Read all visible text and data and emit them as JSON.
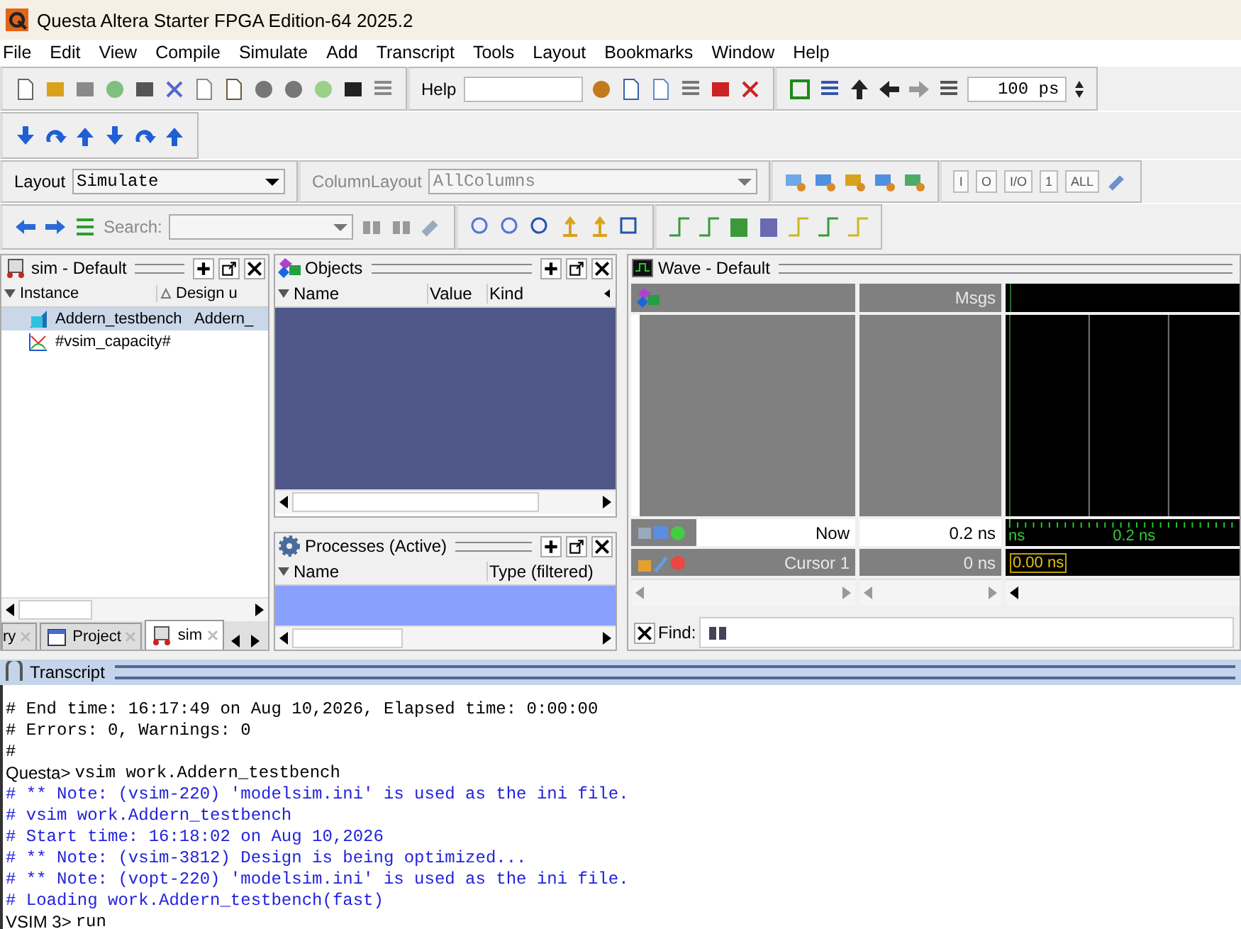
{
  "window": {
    "title": "Questa Altera Starter FPGA Edition-64 2025.2"
  },
  "menu": [
    "File",
    "Edit",
    "View",
    "Compile",
    "Simulate",
    "Add",
    "Transcript",
    "Tools",
    "Layout",
    "Bookmarks",
    "Window",
    "Help"
  ],
  "toolbar": {
    "help_label": "Help",
    "time_step": "100 ps",
    "layout_label": "Layout",
    "layout_value": "Simulate",
    "column_layout_label": "ColumnLayout",
    "column_layout_value": "AllColumns",
    "search_label": "Search:"
  },
  "filter_buttons": [
    "I",
    "O",
    "I/O",
    "1",
    "ALL"
  ],
  "sim_pane": {
    "title": "sim - Default",
    "columns": [
      "Instance",
      "Design u"
    ],
    "rows": [
      {
        "instance": "Addern_testbench",
        "design_unit": "Addern_",
        "kind": "module",
        "selected": true
      },
      {
        "instance": "#vsim_capacity#",
        "kind": "capacity",
        "selected": false
      }
    ]
  },
  "tabs": [
    {
      "label": "ry",
      "selected": false
    },
    {
      "label": "Project",
      "selected": false
    },
    {
      "label": "sim",
      "selected": true
    }
  ],
  "objects": {
    "title": "Objects",
    "columns": [
      "Name",
      "Value",
      "Kind"
    ]
  },
  "processes": {
    "title": "Processes (Active)",
    "columns": [
      "Name",
      "Type (filtered)"
    ]
  },
  "wave": {
    "title": "Wave - Default",
    "msgs_header": "Msgs",
    "now_label": "Now",
    "now_value": "0.2 ns",
    "cursor_label": "Cursor 1",
    "cursor_value": "0 ns",
    "ruler_labels": [
      "ns",
      "0.2 ns"
    ],
    "cursor_time": "0.00 ns",
    "find_label": "Find:"
  },
  "transcript": {
    "title": "Transcript",
    "lines": [
      {
        "kind": "log",
        "text": "# End time: 16:17:49 on Aug 10,2026, Elapsed time: 0:00:00"
      },
      {
        "kind": "log",
        "text": "# Errors: 0, Warnings: 0"
      },
      {
        "kind": "log",
        "text": "#"
      },
      {
        "kind": "prompt",
        "prompt": "Questa>",
        "text": "vsim work.Addern_testbench"
      },
      {
        "kind": "note",
        "text": "# ** Note: (vsim-220) 'modelsim.ini' is used as the ini file."
      },
      {
        "kind": "note",
        "text": "# vsim work.Addern_testbench"
      },
      {
        "kind": "note",
        "text": "# Start time: 16:18:02 on Aug 10,2026"
      },
      {
        "kind": "note",
        "text": "# ** Note: (vsim-3812) Design is being optimized..."
      },
      {
        "kind": "note",
        "text": "# ** Note: (vopt-220) 'modelsim.ini' is used as the ini file."
      },
      {
        "kind": "note",
        "text": "# Loading work.Addern_testbench(fast)"
      },
      {
        "kind": "prompt",
        "prompt": "VSIM 3>",
        "text": "run"
      }
    ]
  }
}
